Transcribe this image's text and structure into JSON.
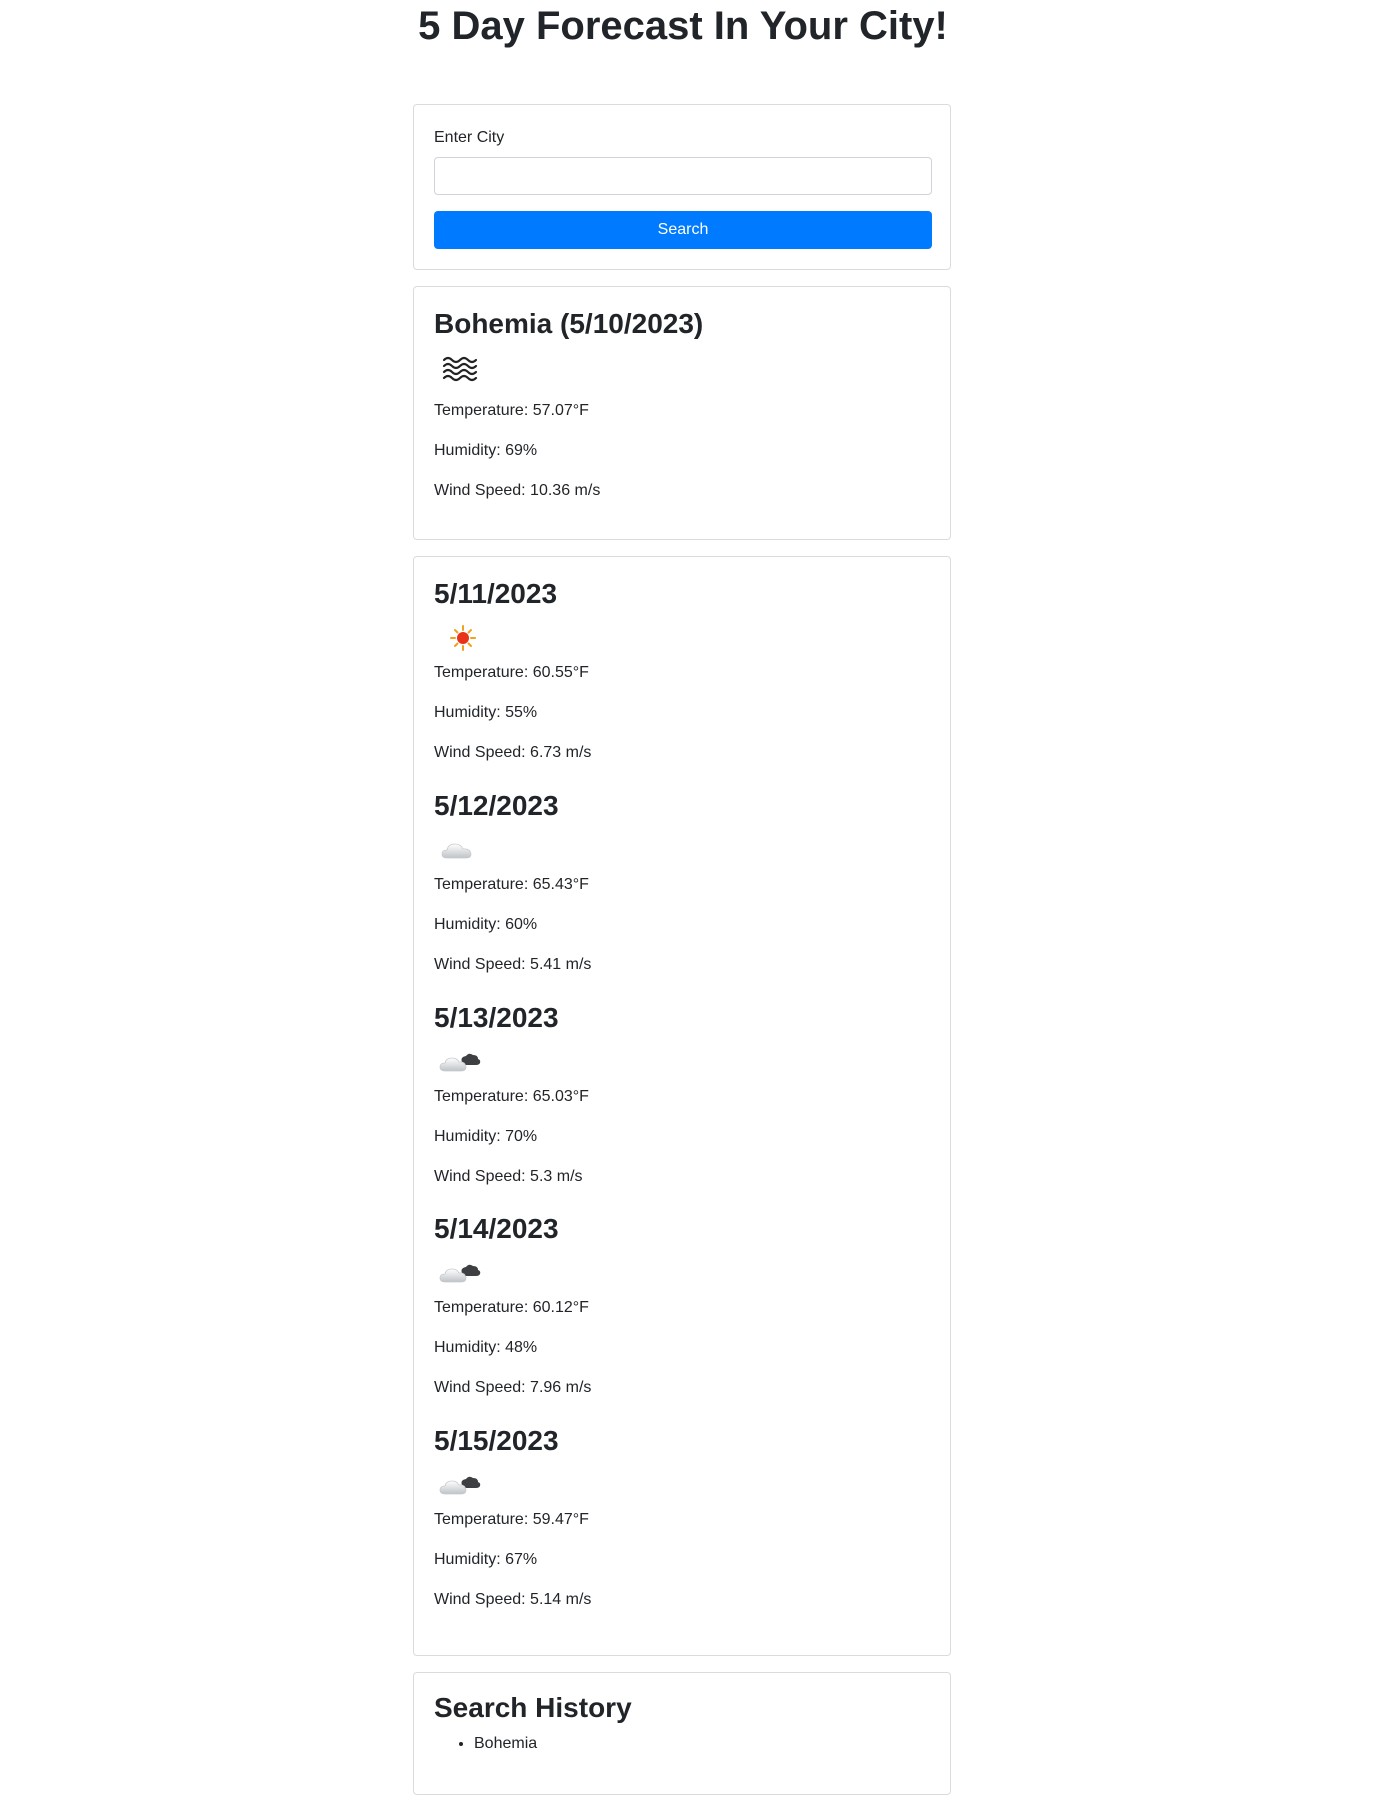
{
  "page": {
    "title": "5 Day Forecast In Your City!"
  },
  "search": {
    "label": "Enter City",
    "input_value": "",
    "placeholder": "",
    "button_label": "Search"
  },
  "current": {
    "heading": "Bohemia (5/10/2023)",
    "icon": "mist-icon",
    "temperature": "Temperature: 57.07°F",
    "humidity": "Humidity: 69%",
    "wind": "Wind Speed: 10.36 m/s"
  },
  "forecast": [
    {
      "date": "5/11/2023",
      "icon": "sun-icon",
      "temperature": "Temperature: 60.55°F",
      "humidity": "Humidity: 55%",
      "wind": "Wind Speed: 6.73 m/s"
    },
    {
      "date": "5/12/2023",
      "icon": "cloud-icon",
      "temperature": "Temperature: 65.43°F",
      "humidity": "Humidity: 60%",
      "wind": "Wind Speed: 5.41 m/s"
    },
    {
      "date": "5/13/2023",
      "icon": "broken-clouds-icon",
      "temperature": "Temperature: 65.03°F",
      "humidity": "Humidity: 70%",
      "wind": "Wind Speed: 5.3 m/s"
    },
    {
      "date": "5/14/2023",
      "icon": "broken-clouds-icon",
      "temperature": "Temperature: 60.12°F",
      "humidity": "Humidity: 48%",
      "wind": "Wind Speed: 7.96 m/s"
    },
    {
      "date": "5/15/2023",
      "icon": "broken-clouds-icon",
      "temperature": "Temperature: 59.47°F",
      "humidity": "Humidity: 67%",
      "wind": "Wind Speed: 5.14 m/s"
    }
  ],
  "history": {
    "heading": "Search History",
    "items": [
      "Bohemia"
    ]
  },
  "colors": {
    "primary": "#007bff",
    "text": "#212529",
    "border": "#d9dcdf",
    "sun": "#e8321a"
  }
}
